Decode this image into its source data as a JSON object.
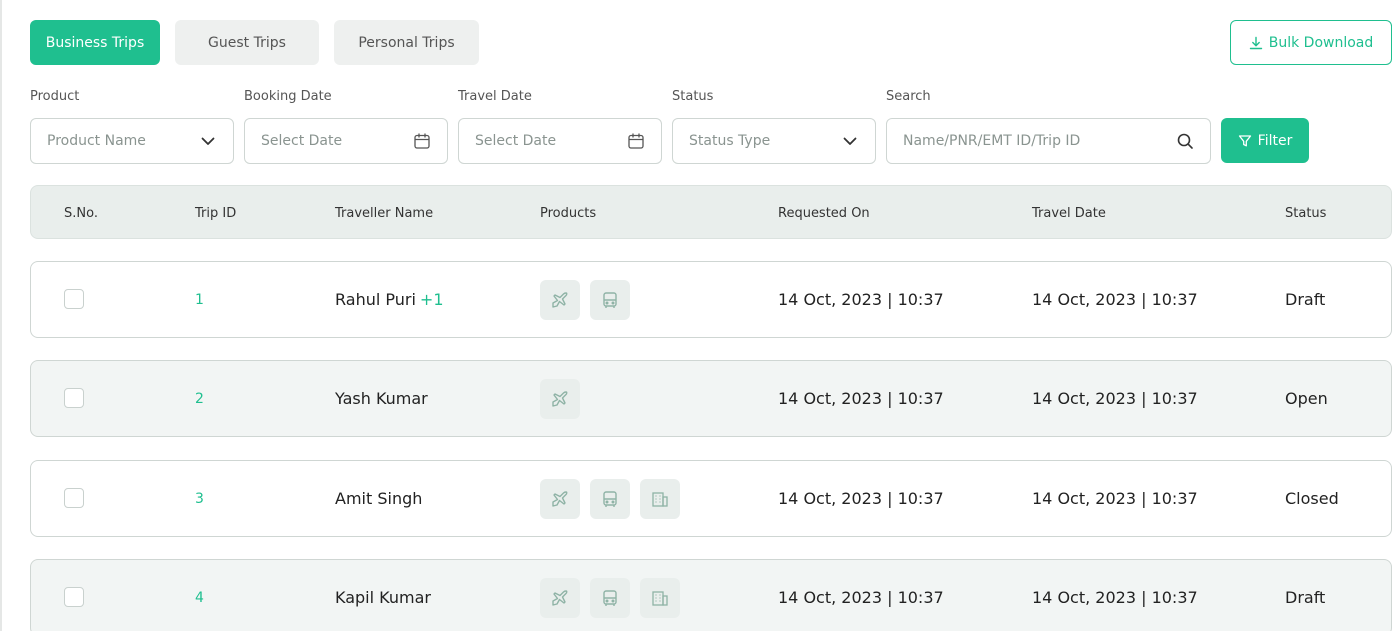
{
  "tabs": [
    {
      "label": "Business Trips",
      "active": true
    },
    {
      "label": "Guest Trips",
      "active": false
    },
    {
      "label": "Personal Trips",
      "active": false
    }
  ],
  "bulk_download": {
    "label": "Bulk Download",
    "icon": "download-icon"
  },
  "filters": {
    "product": {
      "label": "Product",
      "placeholder": "Product Name"
    },
    "booking_date": {
      "label": "Booking Date",
      "placeholder": "Select Date"
    },
    "travel_date": {
      "label": "Travel Date",
      "placeholder": "Select Date"
    },
    "status": {
      "label": "Status",
      "placeholder": "Status Type"
    },
    "search": {
      "label": "Search",
      "placeholder": "Name/PNR/EMT ID/Trip ID"
    },
    "filter_button": "Filter"
  },
  "table": {
    "headers": [
      "S.No.",
      "Trip ID",
      "Traveller Name",
      "Products",
      "Requested On",
      "Travel Date",
      "Status"
    ],
    "rows": [
      {
        "trip_id": "1",
        "traveller": "Rahul Puri",
        "extra": "+1",
        "products": [
          "flight-icon",
          "bus-icon"
        ],
        "requested_on": "14 Oct, 2023 | 10:37",
        "travel_date": "14 Oct, 2023 | 10:37",
        "status": "Draft"
      },
      {
        "trip_id": "2",
        "traveller": "Yash Kumar",
        "extra": "",
        "products": [
          "flight-icon"
        ],
        "requested_on": "14 Oct, 2023 | 10:37",
        "travel_date": "14 Oct, 2023 | 10:37",
        "status": "Open"
      },
      {
        "trip_id": "3",
        "traveller": "Amit Singh",
        "extra": "",
        "products": [
          "flight-icon",
          "bus-icon",
          "hotel-icon"
        ],
        "requested_on": "14 Oct, 2023 | 10:37",
        "travel_date": "14 Oct, 2023 | 10:37",
        "status": "Closed"
      },
      {
        "trip_id": "4",
        "traveller": "Kapil Kumar",
        "extra": "",
        "products": [
          "flight-icon",
          "bus-icon",
          "hotel-icon"
        ],
        "requested_on": "14 Oct, 2023 | 10:37",
        "travel_date": "14 Oct, 2023 | 10:37",
        "status": "Draft"
      }
    ]
  },
  "colors": {
    "accent": "#1fbf8f",
    "header_bg": "#e9eeec",
    "icon": "#8fb3a6"
  }
}
